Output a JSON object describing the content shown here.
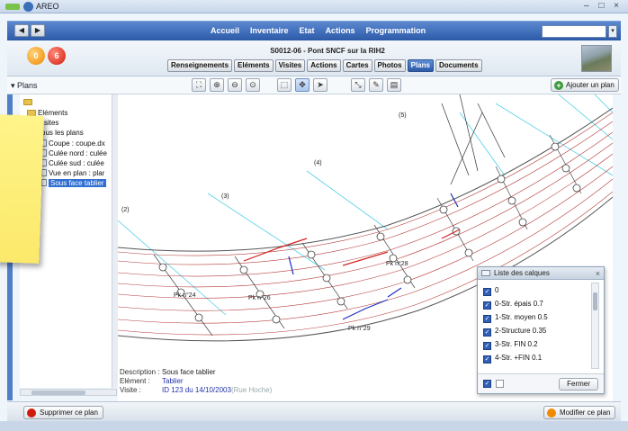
{
  "window": {
    "title": "AREO",
    "controls": "– □ ×"
  },
  "nav": {
    "back": "◀",
    "forward": "▶",
    "links": [
      "Accueil",
      "Inventaire",
      "Etat",
      "Actions",
      "Programmation"
    ],
    "search_value": ""
  },
  "header": {
    "badges": [
      "0",
      "6"
    ],
    "title": "S0012-06 - Pont SNCF sur la RIH2",
    "tabs": [
      "Renseignements",
      "Eléments",
      "Visites",
      "Actions",
      "Cartes",
      "Photos",
      "Plans",
      "Documents"
    ],
    "active_tab": "Plans"
  },
  "toolbar": {
    "plans_label": "▾ Plans",
    "add_plan": "Ajouter un plan",
    "tools": [
      {
        "name": "fit-icon",
        "glyph": "⛶"
      },
      {
        "name": "zoom-in-icon",
        "glyph": "⊕"
      },
      {
        "name": "zoom-out-icon",
        "glyph": "⊖"
      },
      {
        "name": "zoom-reset-icon",
        "glyph": "⊙"
      },
      {
        "name": "select-zoom-icon",
        "glyph": "⬚"
      },
      {
        "name": "pan-icon",
        "glyph": "✥"
      },
      {
        "name": "pointer-icon",
        "glyph": "➤"
      },
      {
        "name": "measure-icon",
        "glyph": "⤡"
      },
      {
        "name": "pencil-icon",
        "glyph": "✎"
      },
      {
        "name": "layers-icon",
        "glyph": "▤"
      }
    ]
  },
  "tree": {
    "items": [
      {
        "label": "",
        "type": "folder",
        "indent": 0
      },
      {
        "label": "Eléments",
        "type": "folder",
        "indent": 1
      },
      {
        "label": "Visites",
        "type": "folder",
        "indent": 1
      },
      {
        "label": "Tous les plans",
        "type": "folder",
        "indent": 1
      },
      {
        "label": "Coupe : coupe.dx",
        "type": "doc",
        "indent": 2
      },
      {
        "label": "Culée nord : culée",
        "type": "doc",
        "indent": 2
      },
      {
        "label": "Culée sud : culée",
        "type": "doc",
        "indent": 2
      },
      {
        "label": "Vue en plan : plar",
        "type": "doc",
        "indent": 2
      },
      {
        "label": "Sous face tablier",
        "type": "doc",
        "indent": 2,
        "selected": true
      }
    ]
  },
  "plan": {
    "section_labels": [
      "(2)",
      "(3)",
      "(4)",
      "(5)"
    ],
    "pile_labels": [
      "Pk n°24",
      "Pk n°26",
      "Pk n°28",
      "Pk n°29"
    ],
    "info": {
      "description_label": "Description :",
      "description_value": "Sous face tablier",
      "element_label": "Elément :",
      "element_value": "Tablier",
      "visite_label": "Visite :",
      "visite_value": "ID 123 du 14/10/2003",
      "visite_note": "(Rue Hoche)"
    }
  },
  "layers": {
    "title": "Liste des calques",
    "items": [
      "0",
      "0-Str. épais 0.7",
      "1-Str. moyen 0.5",
      "2-Structure 0.35",
      "3-Str. FIN 0.2",
      "4-Str. +FIN 0.1"
    ],
    "close_button": "Fermer"
  },
  "footer": {
    "delete_plan": "Supprimer ce plan",
    "edit_plan": "Modifier ce plan"
  },
  "colors": {
    "nav_blue": "#2c5aa8",
    "delete_red": "#d21a0a",
    "edit_orange": "#f08a00",
    "add_green": "#3a9b3a"
  }
}
